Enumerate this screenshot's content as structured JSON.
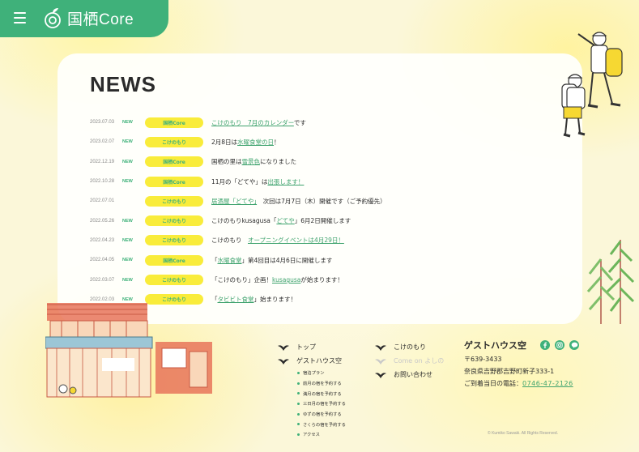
{
  "header": {
    "logo_text": "国栖Core"
  },
  "news": {
    "title": "NEWS",
    "items": [
      {
        "date": "2023.07.03",
        "new": "NEW",
        "tag": "国栖Core",
        "pre": "",
        "link": "こけのもり　7月のカレンダー",
        "post": "です"
      },
      {
        "date": "2023.02.07",
        "new": "NEW",
        "tag": "こけのもり",
        "pre": "2月8日は",
        "link": "水曜食堂の日",
        "post": "！"
      },
      {
        "date": "2022.12.19",
        "new": "NEW",
        "tag": "国栖Core",
        "pre": "国栖の里は",
        "link": "雪景色",
        "post": "になりました"
      },
      {
        "date": "2022.10.28",
        "new": "NEW",
        "tag": "国栖Core",
        "pre": "11月の「どてや」は",
        "link": "出張します！",
        "post": ""
      },
      {
        "date": "2022.07.01",
        "new": "",
        "tag": "こけのもり",
        "pre": "",
        "link": "居酒屋「どてや」",
        "post": "　次回は7月7日（木）開催です（ご予約優先）"
      },
      {
        "date": "2022.05.26",
        "new": "NEW",
        "tag": "こけのもり",
        "pre": "こけのもりkusagusa「",
        "link": "どてや",
        "post": "」6月2日開催します"
      },
      {
        "date": "2022.04.23",
        "new": "NEW",
        "tag": "こけのもり",
        "pre": "こけのもり　",
        "link": "オープニングイベントは4月29日！",
        "post": ""
      },
      {
        "date": "2022.04.05",
        "new": "NEW",
        "tag": "国栖Core",
        "pre": "「",
        "link": "水曜食堂",
        "post": "」第4回目は4月6日に開催します"
      },
      {
        "date": "2022.03.07",
        "new": "NEW",
        "tag": "こけのもり",
        "pre": "「こけのもり」企画！",
        "link": "kusagusa",
        "post": "が始まります！"
      },
      {
        "date": "2022.02.03",
        "new": "NEW",
        "tag": "こけのもり",
        "pre": "「",
        "link": "タビビト食堂",
        "post": "」始まります！"
      }
    ]
  },
  "footer": {
    "nav_col1": [
      {
        "label": "トップ"
      },
      {
        "label": "ゲストハウス空"
      }
    ],
    "sub_items": [
      "宿泊プラン",
      "前月の宿を予約する",
      "満月の宿を予約する",
      "三日月の宿を予約する",
      "ゆずの宿を予約する",
      "さくらの宿を予約する",
      "アクセス"
    ],
    "nav_col2": [
      {
        "label": "こけのもり",
        "muted": false
      },
      {
        "label": "Come on よしの",
        "muted": true
      },
      {
        "label": "お問い合わせ",
        "muted": false
      }
    ],
    "guest": {
      "name": "ゲストハウス空",
      "zip": "〒639-3433",
      "address": "奈良県吉野郡吉野町新子333-1",
      "tel_label": "ご到着当日の電話：",
      "tel": "0746-47-2126"
    },
    "socials": [
      "facebook-icon",
      "instagram-icon",
      "line-icon"
    ],
    "copyright": "© Kumiko Sawaki. All Rights Reserved."
  },
  "colors": {
    "accent": "#3fb17a",
    "tag_bg": "#f9ec3a",
    "link": "#3fa36e"
  }
}
